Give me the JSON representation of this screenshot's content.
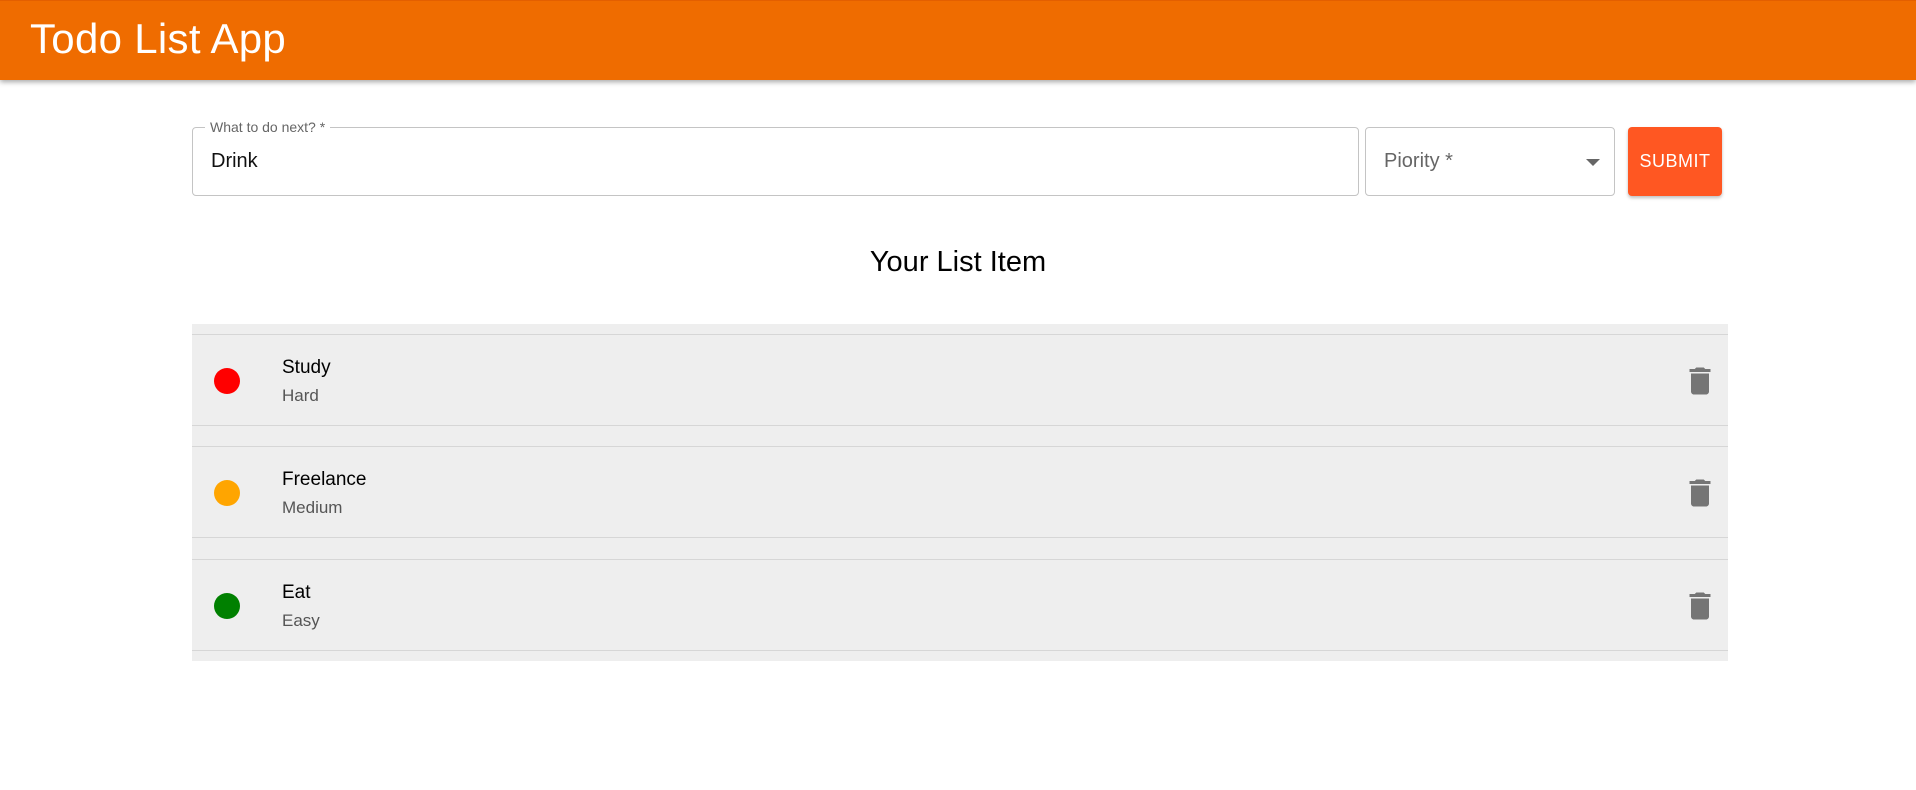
{
  "appbar": {
    "title": "Todo List App"
  },
  "form": {
    "task_label": "What to do next? *",
    "task_value": "Drink",
    "priority_label": "Piority *",
    "submit_label": "SUBMIT"
  },
  "list": {
    "heading": "Your List Item",
    "items": [
      {
        "title": "Study",
        "difficulty": "Hard",
        "color": "#ff0000"
      },
      {
        "title": "Freelance",
        "difficulty": "Medium",
        "color": "#ffa500"
      },
      {
        "title": "Eat",
        "difficulty": "Easy",
        "color": "#008000"
      }
    ]
  },
  "colors": {
    "appbar": "#ef6c00",
    "submit": "#ff5722",
    "list_bg": "#eeeeee",
    "delete_icon": "#757575"
  },
  "icons": {
    "delete": "trash-icon",
    "select": "caret-down-icon"
  }
}
